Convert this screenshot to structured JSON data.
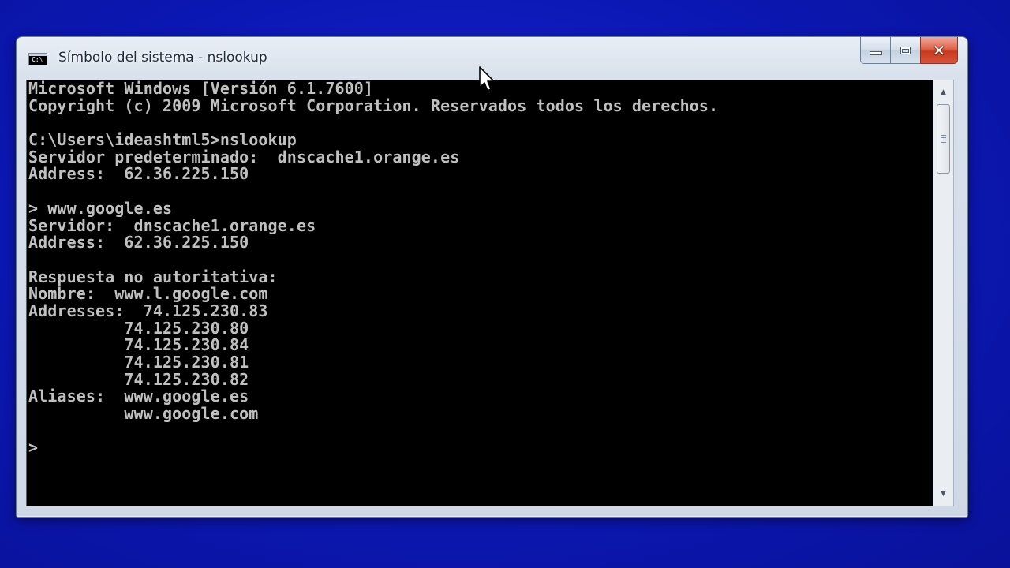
{
  "window": {
    "title": "Símbolo del sistema - nslookup",
    "close_glyph": "✕"
  },
  "app_icon": {
    "text": "C:\\"
  },
  "console": {
    "lines": [
      "Microsoft Windows [Versión 6.1.7600]",
      "Copyright (c) 2009 Microsoft Corporation. Reservados todos los derechos.",
      "",
      "C:\\Users\\ideashtml5>nslookup",
      "Servidor predeterminado:  dnscache1.orange.es",
      "Address:  62.36.225.150",
      "",
      "> www.google.es",
      "Servidor:  dnscache1.orange.es",
      "Address:  62.36.225.150",
      "",
      "Respuesta no autoritativa:",
      "Nombre:  www.l.google.com",
      "Addresses:  74.125.230.83",
      "          74.125.230.80",
      "          74.125.230.84",
      "          74.125.230.81",
      "          74.125.230.82",
      "Aliases:  www.google.es",
      "          www.google.com",
      "",
      ">"
    ]
  },
  "scrollbar": {
    "up_glyph": "▲",
    "down_glyph": "▼"
  },
  "icons": {
    "app": "console-icon",
    "minimize": "minimize-icon",
    "maximize": "maximize-icon",
    "close": "close-icon",
    "cursor": "mouse-pointer-icon"
  },
  "colors": {
    "desktop": "#0d18b8",
    "console_bg": "#000000",
    "console_text": "#c0c0c0",
    "close_button": "#c8391f"
  }
}
